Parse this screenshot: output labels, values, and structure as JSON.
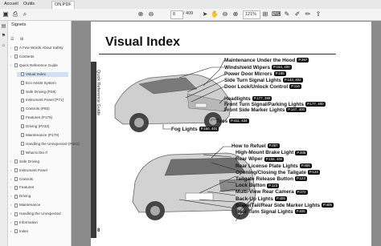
{
  "tabs": [
    "Accueil",
    "Outils",
    "ON.PDF"
  ],
  "toolbar": {
    "page_current": "8",
    "page_total": "/ 409",
    "zoom": "121%"
  },
  "bookmarks": {
    "title": "Signets",
    "items": [
      {
        "label": "A Few Words About Safety",
        "level": 0
      },
      {
        "label": "Contents",
        "level": 0
      },
      {
        "label": "Quick Reference Guide",
        "level": 0
      },
      {
        "label": "Visual Index",
        "level": 1,
        "selected": true
      },
      {
        "label": "Eco Assist System",
        "level": 1
      },
      {
        "label": "Safe Driving (P29)",
        "level": 1
      },
      {
        "label": "Instrument Panel (P71)",
        "level": 1
      },
      {
        "label": "Controls (P93)",
        "level": 1
      },
      {
        "label": "Features (P175)",
        "level": 1
      },
      {
        "label": "Driving (P233)",
        "level": 1
      },
      {
        "label": "Maintenance (P179)",
        "level": 1
      },
      {
        "label": "Handling the Unexpected (P431)",
        "level": 1
      },
      {
        "label": "What to Do If",
        "level": 1
      },
      {
        "label": "Safe Driving",
        "level": 0
      },
      {
        "label": "Instrument Panel",
        "level": 0
      },
      {
        "label": "Controls",
        "level": 0
      },
      {
        "label": "Features",
        "level": 0
      },
      {
        "label": "Driving",
        "level": 0
      },
      {
        "label": "Maintenance",
        "level": 0
      },
      {
        "label": "Handling the Unexpected",
        "level": 0
      },
      {
        "label": "Information",
        "level": 0
      },
      {
        "label": "Index",
        "level": 0
      }
    ]
  },
  "page": {
    "side_tab": "Quick Reference Guide",
    "title": "Visual Index",
    "page_number": "8",
    "front_labels": [
      {
        "text": "Maintenance Under the Hood",
        "ref": "P.367"
      },
      {
        "text": "Windshield Wipers",
        "ref": "P.154, 400"
      },
      {
        "text": "Power Door Mirrors",
        "ref": "P.165"
      },
      {
        "text": "Side Turn Signal Lights",
        "ref": "P.143, 402"
      },
      {
        "text": "Door Lock/Unlock Control",
        "ref": "P.116"
      },
      {
        "text": "Headlights",
        "ref": "P.177, 399"
      },
      {
        "text": "Front Turn Signal/Parking Lights",
        "ref": "P.177, 400"
      },
      {
        "text": "Front Side Marker Lights",
        "ref": "P.147, 400"
      },
      {
        "text": "Tires",
        "ref": "P.411, 434"
      },
      {
        "text": "Fog Lights",
        "ref": "P.150, 401"
      }
    ],
    "rear_labels": [
      {
        "text": "How to Refuel",
        "ref": "P.287"
      },
      {
        "text": "High-Mount Brake Light",
        "ref": "P.405"
      },
      {
        "text": "Rear Wiper",
        "ref": "P.155, 404"
      },
      {
        "text": "Rear License Plate Lights",
        "ref": "P.406"
      },
      {
        "text": "Opening/Closing the Tailgate",
        "ref": "P.123"
      },
      {
        "text": "Tailgate Release Button",
        "ref": "P.123"
      },
      {
        "text": "Lock Button",
        "ref": "P.123"
      },
      {
        "text": "Multi-View Rear Camera",
        "ref": "P.272"
      },
      {
        "text": "Back-Up Lights",
        "ref": "P.405"
      },
      {
        "text": "Brake/Tail/Rear Side Marker Lights",
        "ref": "P.405"
      },
      {
        "text": "Rear Turn Signal Lights",
        "ref": "P.405"
      }
    ]
  }
}
